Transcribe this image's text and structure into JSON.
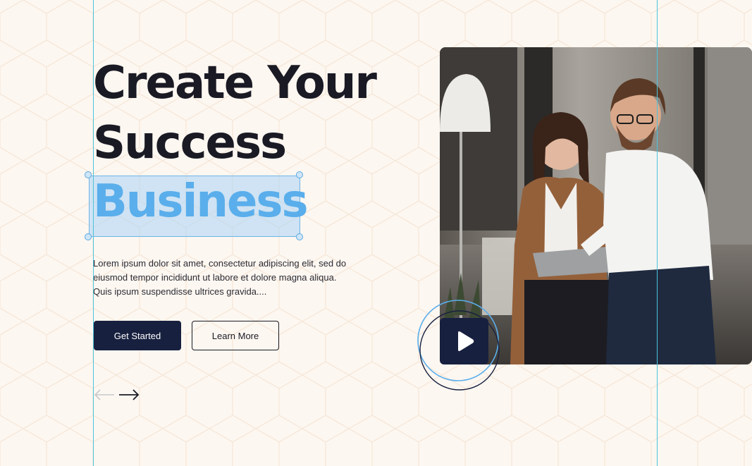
{
  "hero": {
    "title_line1": "Create Your",
    "title_line2": "Success",
    "title_highlight": "Business",
    "description": "Lorem ipsum dolor sit amet, consectetur adipiscing elit, sed do eiusmod tempor incididunt ut labore et dolore magna aliqua. Quis ipsum suspendisse ultrices gravida...."
  },
  "buttons": {
    "primary_label": "Get Started",
    "secondary_label": "Learn More"
  },
  "slider_nav": {
    "prev_icon": "arrow-left-icon",
    "next_icon": "arrow-right-icon"
  },
  "media": {
    "image": "two-business-people-with-tablet-photo",
    "play_icon": "play-icon"
  },
  "colors": {
    "background": "#fdf7f1",
    "heading": "#1a1a24",
    "highlight_text": "#5aaeeb",
    "selection_fill": "#aad4f5",
    "selection_border": "#6db4e8",
    "primary_button": "#17203f",
    "guide_line": "#4cc3dc"
  }
}
